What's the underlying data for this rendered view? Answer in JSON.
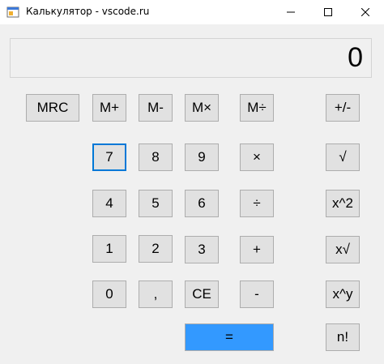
{
  "window": {
    "title": "Калькулятор - vscode.ru",
    "icons": {
      "app": "app-window-icon",
      "minimize": "minimize-icon",
      "maximize": "maximize-icon",
      "close": "close-icon"
    }
  },
  "display": {
    "value": "0"
  },
  "buttons": {
    "mrc": "MRC",
    "m_plus": "M+",
    "m_minus": "M-",
    "m_mul": "M×",
    "m_div": "M÷",
    "plus_minus": "+/-",
    "seven": "7",
    "eight": "8",
    "nine": "9",
    "multiply": "×",
    "sqrt": "√",
    "four": "4",
    "five": "5",
    "six": "6",
    "divide": "÷",
    "square": "x^2",
    "one": "1",
    "two": "2",
    "three": "3",
    "plus": "+",
    "nth_root": "x√",
    "zero": "0",
    "comma": ",",
    "ce": "CE",
    "minus": "-",
    "power": "x^y",
    "equals": "=",
    "factorial": "n!"
  },
  "colors": {
    "equals_bg": "#3399ff",
    "focus_border": "#0078d7"
  }
}
